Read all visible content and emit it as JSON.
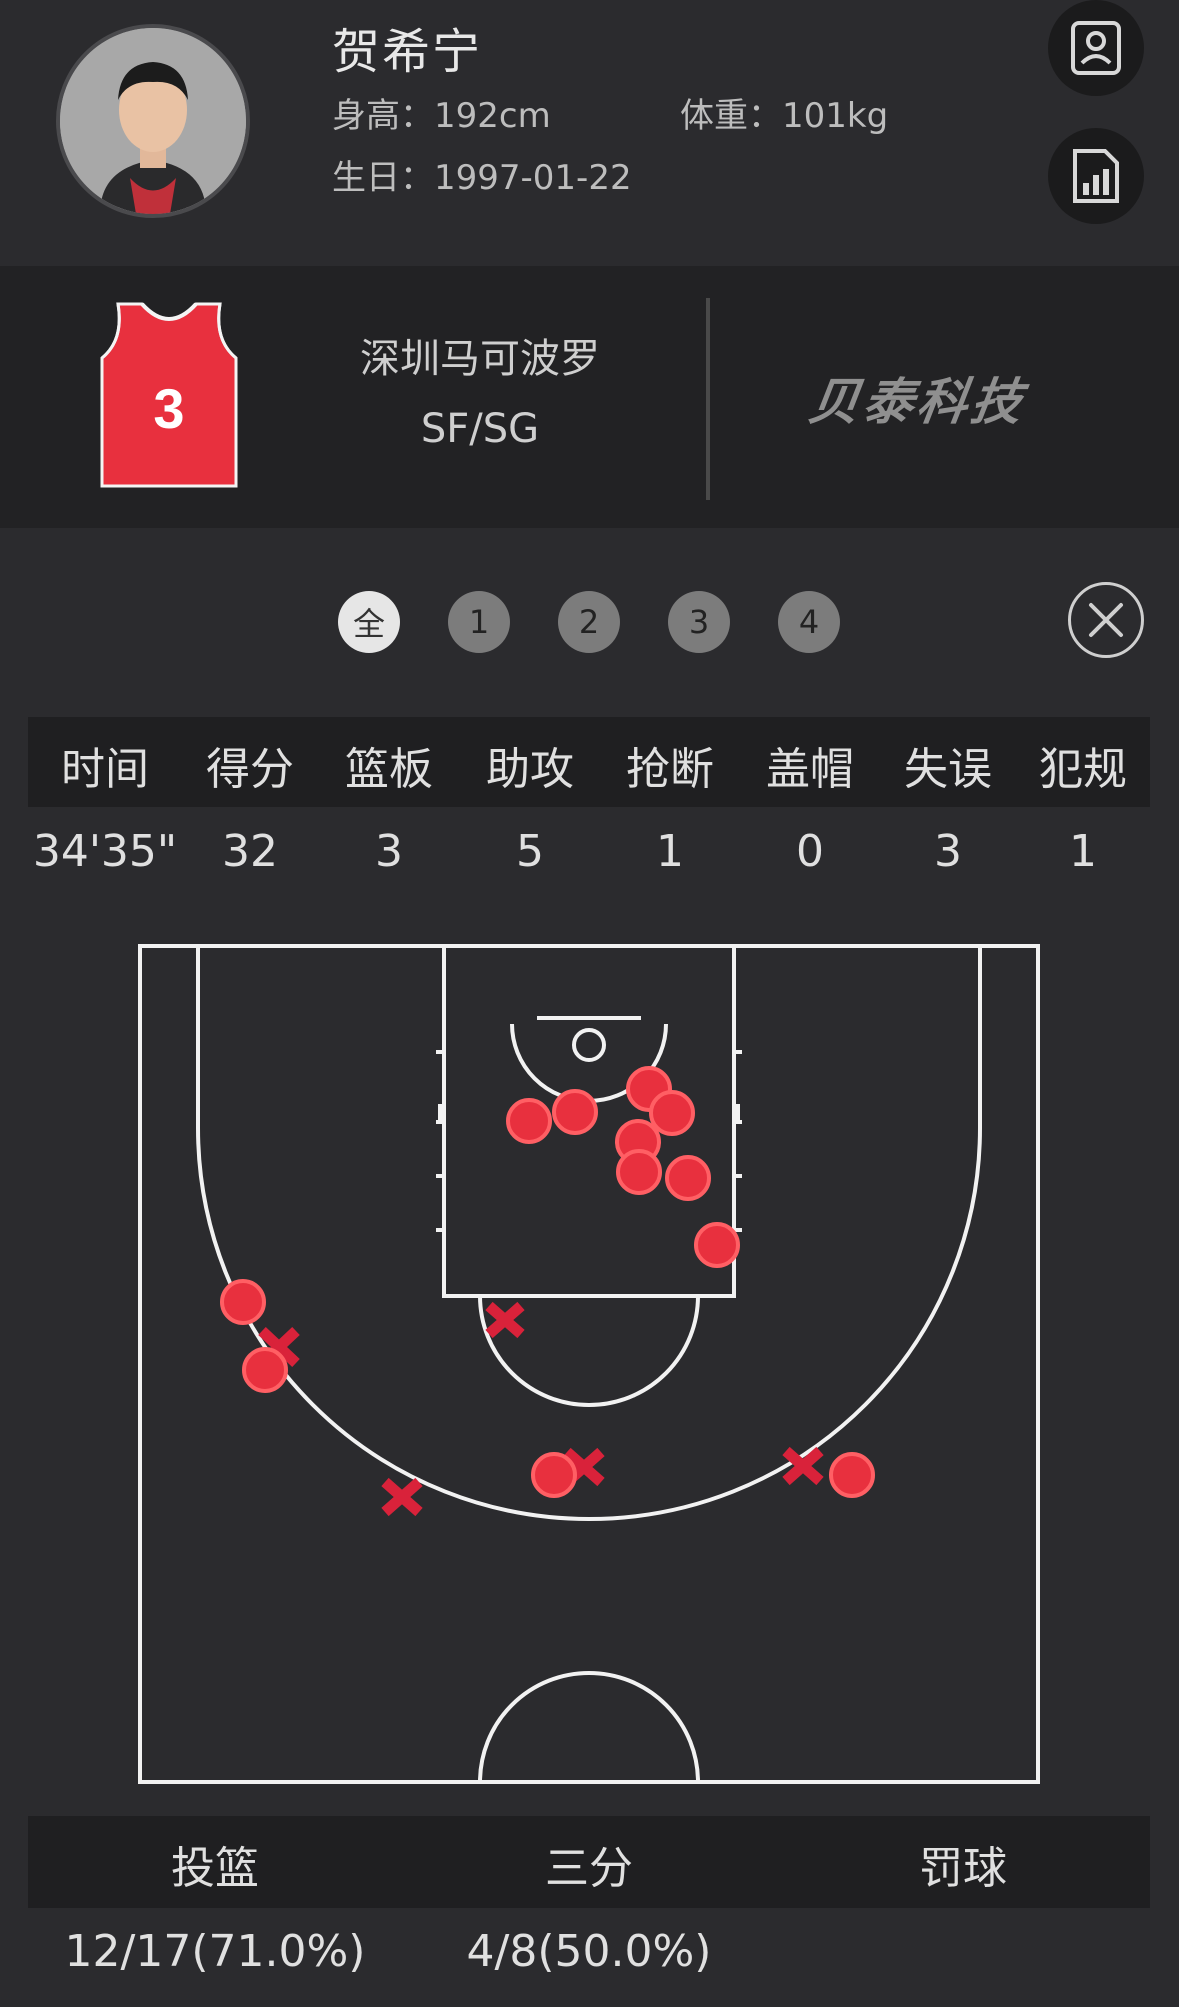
{
  "player": {
    "name": "贺希宁",
    "height": "身高：192cm",
    "weight": "体重：101kg",
    "birthday": "生日：1997-01-22"
  },
  "team": {
    "name": "深圳马可波罗",
    "position": "SF/SG",
    "jersey_number": "3",
    "jersey_color": "#e8303e"
  },
  "brand": {
    "logo_text": "贝泰科技"
  },
  "periods": [
    "全",
    "1",
    "2",
    "3",
    "4"
  ],
  "active_period": "全",
  "stats": {
    "headers": [
      "时间",
      "得分",
      "篮板",
      "助攻",
      "抢断",
      "盖帽",
      "失误",
      "犯规"
    ],
    "values": [
      "34'35\"",
      "32",
      "3",
      "5",
      "1",
      "0",
      "3",
      "1"
    ]
  },
  "shooting": {
    "headers": [
      "投篮",
      "三分",
      "罚球"
    ],
    "values": [
      "12/17(71.0%)",
      "4/8(50.0%)",
      ""
    ]
  },
  "colors": {
    "made_shot": "#e8303e",
    "missed_shot": "#d9223a",
    "background": "#2b2b2e"
  },
  "icons": {
    "profile": "profile-card-icon",
    "stats": "bar-chart-document-icon",
    "close": "close-icon"
  }
}
